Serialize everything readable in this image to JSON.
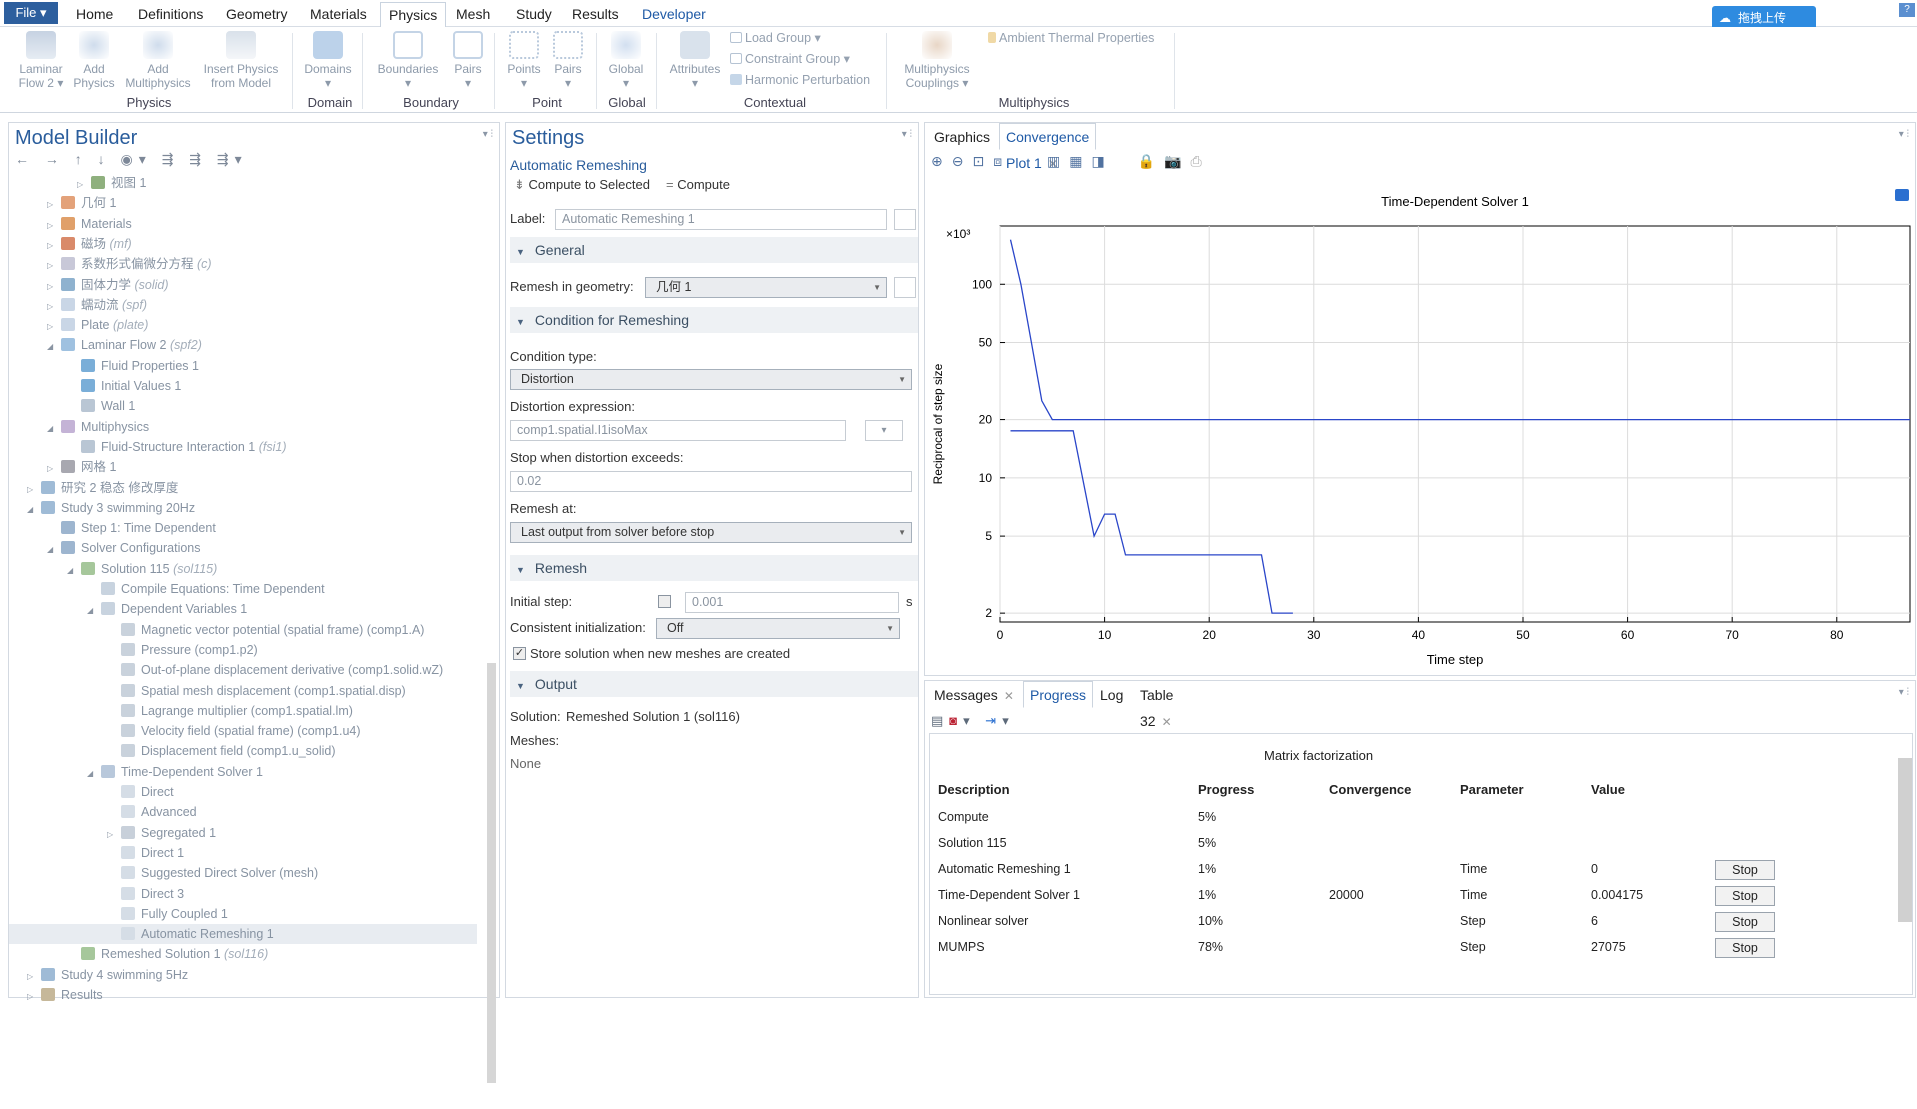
{
  "menu": {
    "file": "File ▾",
    "tabs": [
      "Home",
      "Definitions",
      "Geometry",
      "Materials",
      "Physics",
      "Mesh",
      "Study",
      "Results",
      "Developer"
    ],
    "active_tab": "Physics",
    "upload": "拖拽上传",
    "help": "?"
  },
  "ribbon": {
    "buttons": [
      {
        "l1": "Laminar",
        "l2": "Flow 2 ▾"
      },
      {
        "l1": "Add",
        "l2": "Physics"
      },
      {
        "l1": "Add",
        "l2": "Multiphysics"
      },
      {
        "l1": "Insert Physics",
        "l2": "from Model"
      },
      {
        "l1": "Domains",
        "l2": "▾"
      },
      {
        "l1": "Boundaries",
        "l2": "▾"
      },
      {
        "l1": "Pairs",
        "l2": "▾"
      },
      {
        "l1": "Points",
        "l2": "▾"
      },
      {
        "l1": "Pairs",
        "l2": "▾"
      },
      {
        "l1": "Global",
        "l2": "▾"
      },
      {
        "l1": "Attributes",
        "l2": "▾"
      },
      {
        "l1": "Multiphysics",
        "l2": "Couplings ▾"
      }
    ],
    "small": [
      "Load Group ▾",
      "Constraint Group ▾",
      "Harmonic Perturbation",
      "Ambient Thermal Properties"
    ],
    "groups": [
      "Physics",
      "Domain",
      "Boundary",
      "Point",
      "Global",
      "Contextual",
      "Multiphysics"
    ]
  },
  "model_builder": {
    "title": "Model Builder",
    "toolbar": "← → ↑ ↓ ◉▾ ⇶ ⇶ ⇶▾",
    "nodes": [
      {
        "label": "视图 1",
        "tag": ""
      },
      {
        "label": "几何 1",
        "tag": ""
      },
      {
        "label": "Materials",
        "tag": ""
      },
      {
        "label": "磁场",
        "tag": "(mf)"
      },
      {
        "label": "系数形式偏微分方程",
        "tag": "(c)"
      },
      {
        "label": "固体力学",
        "tag": "(solid)"
      },
      {
        "label": "蠕动流",
        "tag": "(spf)"
      },
      {
        "label": "Plate",
        "tag": "(plate)"
      },
      {
        "label": "Laminar Flow 2",
        "tag": "(spf2)"
      },
      {
        "label": "Fluid Properties 1",
        "tag": ""
      },
      {
        "label": "Initial Values 1",
        "tag": ""
      },
      {
        "label": "Wall 1",
        "tag": ""
      },
      {
        "label": "Multiphysics",
        "tag": ""
      },
      {
        "label": "Fluid-Structure Interaction 1",
        "tag": "(fsi1)"
      },
      {
        "label": "网格 1",
        "tag": ""
      },
      {
        "label": "研究 2  稳态 修改厚度",
        "tag": ""
      },
      {
        "label": "Study 3 swimming 20Hz",
        "tag": ""
      },
      {
        "label": "Step 1: Time Dependent",
        "tag": ""
      },
      {
        "label": "Solver Configurations",
        "tag": ""
      },
      {
        "label": "Solution 115",
        "tag": "(sol115)"
      },
      {
        "label": "Compile Equations: Time Dependent",
        "tag": ""
      },
      {
        "label": "Dependent Variables 1",
        "tag": ""
      },
      {
        "label": "Magnetic vector potential (spatial frame) (comp1.A)",
        "tag": ""
      },
      {
        "label": "Pressure (comp1.p2)",
        "tag": ""
      },
      {
        "label": "Out-of-plane displacement derivative (comp1.solid.wZ)",
        "tag": ""
      },
      {
        "label": "Spatial mesh displacement (comp1.spatial.disp)",
        "tag": ""
      },
      {
        "label": "Lagrange multiplier (comp1.spatial.lm)",
        "tag": ""
      },
      {
        "label": "Velocity field (spatial frame) (comp1.u4)",
        "tag": ""
      },
      {
        "label": "Displacement field (comp1.u_solid)",
        "tag": ""
      },
      {
        "label": "Time-Dependent Solver 1",
        "tag": ""
      },
      {
        "label": "Direct",
        "tag": ""
      },
      {
        "label": "Advanced",
        "tag": ""
      },
      {
        "label": "Segregated 1",
        "tag": ""
      },
      {
        "label": "Direct 1",
        "tag": ""
      },
      {
        "label": "Suggested Direct Solver (mesh)",
        "tag": ""
      },
      {
        "label": "Direct 3",
        "tag": ""
      },
      {
        "label": "Fully Coupled 1",
        "tag": ""
      },
      {
        "label": "Automatic Remeshing 1",
        "tag": ""
      },
      {
        "label": "Remeshed Solution 1",
        "tag": "(sol116)"
      },
      {
        "label": "Study 4 swimming 5Hz",
        "tag": ""
      },
      {
        "label": "Results",
        "tag": ""
      }
    ]
  },
  "settings": {
    "title": "Settings",
    "subtitle": "Automatic Remeshing",
    "compute_selected": "Compute to Selected",
    "compute": "Compute",
    "label_caption": "Label:",
    "label_value": "Automatic Remeshing 1",
    "sec_general": "General",
    "remesh_geom_caption": "Remesh in geometry:",
    "remesh_geom_value": "几何 1",
    "sec_condition": "Condition for Remeshing",
    "condition_type_caption": "Condition type:",
    "condition_type_value": "Distortion",
    "distortion_expr_caption": "Distortion expression:",
    "distortion_expr_value": "comp1.spatial.I1isoMax",
    "stop_when_caption": "Stop when distortion exceeds:",
    "stop_when_value": "0.02",
    "remesh_at_caption": "Remesh at:",
    "remesh_at_value": "Last output from solver before stop",
    "sec_remesh": "Remesh",
    "initial_step_caption": "Initial step:",
    "initial_step_value": "0.001",
    "initial_step_unit": "s",
    "consistent_caption": "Consistent initialization:",
    "consistent_value": "Off",
    "store_solution": "Store solution when new meshes are created",
    "sec_output": "Output",
    "solution_caption": "Solution:",
    "solution_value": "Remeshed Solution 1 (sol116)",
    "meshes_caption": "Meshes:",
    "meshes_value": "None"
  },
  "graphics": {
    "tabs": [
      "Graphics",
      "Convergence Plot 1"
    ],
    "active_tab": "Convergence Plot 1"
  },
  "chart_data": {
    "type": "line",
    "title": "Time-Dependent Solver 1",
    "xlabel": "Time step",
    "ylabel": "Reciprocal of step size",
    "y_multiplier_label": "×10³",
    "y_scale": "log",
    "xlim": [
      0,
      87
    ],
    "ylim": [
      1.8,
      200
    ],
    "xticks": [
      0,
      10,
      20,
      30,
      40,
      50,
      60,
      70,
      80
    ],
    "yticks": [
      2,
      5,
      10,
      20,
      50,
      100
    ],
    "grid": true,
    "series": [
      {
        "x": [
          1,
          2,
          3,
          4,
          5,
          87
        ],
        "y": [
          170,
          100,
          50,
          25,
          20,
          20
        ]
      },
      {
        "x": [
          1,
          7,
          9,
          10,
          11,
          12,
          25,
          26,
          28
        ],
        "y": [
          17.5,
          17.5,
          5,
          6.5,
          6.5,
          4,
          4,
          2,
          2
        ]
      }
    ],
    "colors": [
      "#2a46c9",
      "#2a46c9"
    ]
  },
  "messages": {
    "tabs": [
      "Messages",
      "Progress",
      "Log",
      "Table 32"
    ],
    "active_tab": "Progress",
    "header": "Matrix factorization",
    "columns": [
      "Description",
      "Progress",
      "Convergence",
      "Parameter",
      "Value"
    ],
    "rows": [
      {
        "desc": "Compute",
        "prog": "5%",
        "conv": "",
        "param": "",
        "val": "",
        "stop": ""
      },
      {
        "desc": "Solution 115",
        "prog": "5%",
        "conv": "",
        "param": "",
        "val": "",
        "stop": ""
      },
      {
        "desc": "Automatic Remeshing 1",
        "prog": "1%",
        "conv": "",
        "param": "Time",
        "val": "0",
        "stop": "Stop"
      },
      {
        "desc": "Time-Dependent Solver 1",
        "prog": "1%",
        "conv": "20000",
        "param": "Time",
        "val": "0.004175",
        "stop": "Stop"
      },
      {
        "desc": "Nonlinear solver",
        "prog": "10%",
        "conv": "",
        "param": "Step",
        "val": "6",
        "stop": "Stop"
      },
      {
        "desc": "MUMPS",
        "prog": "78%",
        "conv": "",
        "param": "Step",
        "val": "27075",
        "stop": "Stop"
      }
    ]
  }
}
